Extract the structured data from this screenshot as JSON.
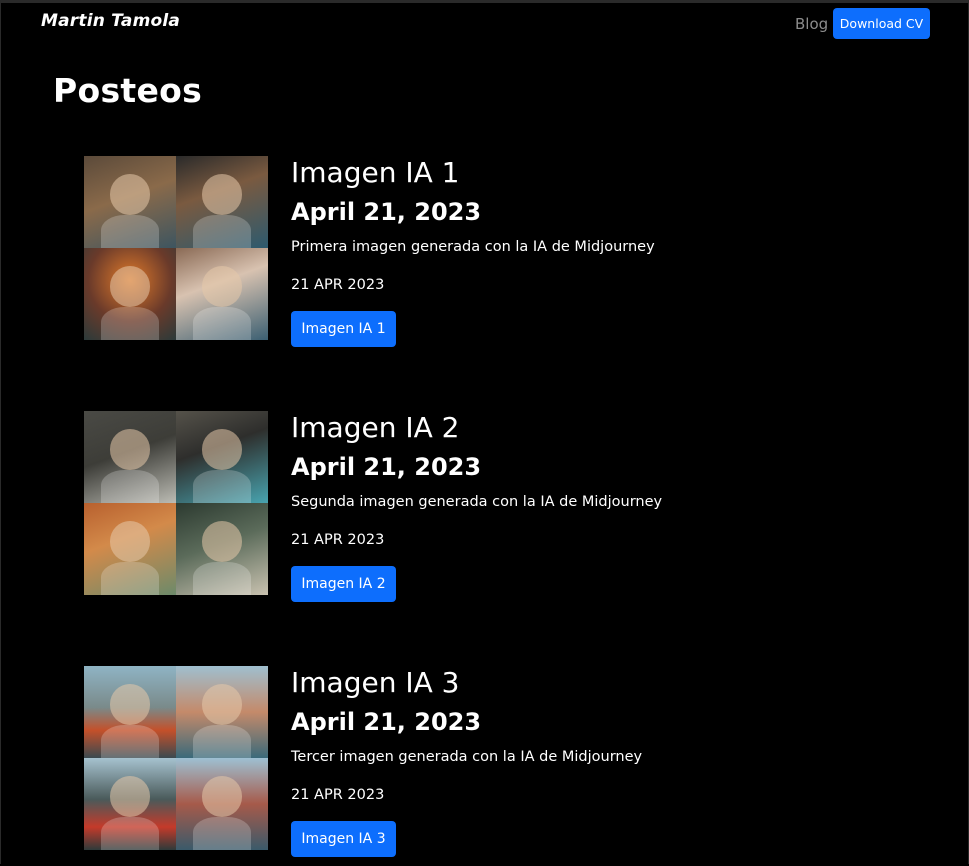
{
  "nav": {
    "brand": "Martin Tamola",
    "blog_label": "Blog",
    "cv_button_label": "Download CV"
  },
  "page": {
    "title": "Posteos"
  },
  "colors": {
    "background": "#000000",
    "primary_button": "#0d6efd",
    "nav_muted": "#8c8c8c"
  },
  "posts": [
    {
      "title": "Imagen IA 1",
      "date_heading": "April 21, 2023",
      "description": "Primera imagen generada con la IA de Midjourney",
      "date_stamp": "21 APR 2023",
      "button_label": "Imagen IA 1"
    },
    {
      "title": "Imagen IA 2",
      "date_heading": "April 21, 2023",
      "description": "Segunda imagen generada con la IA de Midjourney",
      "date_stamp": "21 APR 2023",
      "button_label": "Imagen IA 2"
    },
    {
      "title": "Imagen IA 3",
      "date_heading": "April 21, 2023",
      "description": "Tercer imagen generada con la IA de Midjourney",
      "date_stamp": "21 APR 2023",
      "button_label": "Imagen IA 3"
    }
  ]
}
